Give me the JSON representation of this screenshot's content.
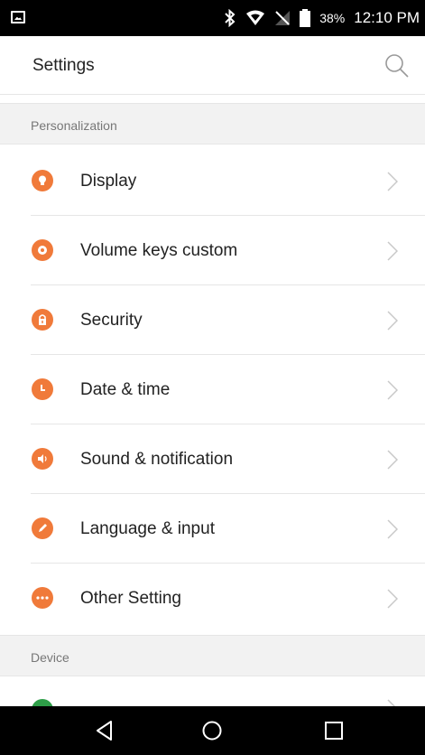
{
  "status_bar": {
    "battery_percent": "38%",
    "time": "12:10 PM",
    "icons": [
      "screenshot-icon",
      "bluetooth-icon",
      "wifi-icon",
      "no-sim-icon",
      "battery-icon"
    ]
  },
  "app_bar": {
    "title": "Settings",
    "search_icon": "search-icon"
  },
  "sections": [
    {
      "header": "Personalization",
      "items": [
        {
          "label": "Display",
          "icon": "bulb-icon",
          "color": "#f07a3a"
        },
        {
          "label": "Volume keys custom",
          "icon": "gear-icon",
          "color": "#f07a3a"
        },
        {
          "label": "Security",
          "icon": "lock-icon",
          "color": "#f07a3a"
        },
        {
          "label": "Date & time",
          "icon": "clock-icon",
          "color": "#f07a3a"
        },
        {
          "label": "Sound & notification",
          "icon": "speaker-icon",
          "color": "#f07a3a"
        },
        {
          "label": "Language & input",
          "icon": "pencil-icon",
          "color": "#f07a3a"
        },
        {
          "label": "Other Setting",
          "icon": "more-icon",
          "color": "#f07a3a"
        }
      ]
    },
    {
      "header": "Device",
      "items": [
        {
          "label": "",
          "icon": "device-icon",
          "color": "#2e9e48"
        }
      ]
    }
  ],
  "nav_bar": {
    "buttons": [
      "back-icon",
      "home-icon",
      "recents-icon"
    ]
  }
}
